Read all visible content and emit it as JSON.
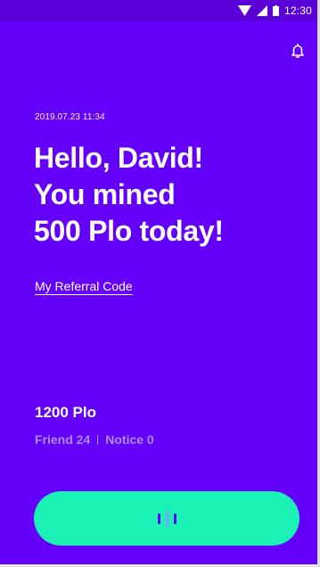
{
  "colors": {
    "background": "#6400fa",
    "status_bar": "#5a00d6",
    "accent_button": "#19f2b4",
    "muted_text": "#a98cf3"
  },
  "status_bar": {
    "icons": [
      "wifi-icon",
      "signal-icon",
      "battery-icon"
    ],
    "time": "12:30"
  },
  "header": {
    "notification_icon": "bell-icon"
  },
  "main": {
    "timestamp": "2019.07.23 11:34",
    "greeting_lines": [
      "Hello, David!",
      "You mined",
      "500 Plo today!"
    ],
    "referral_link": "My Referral Code",
    "balance": "1200 Plo",
    "stats": {
      "friend": "Friend 24",
      "notice": "Notice 0"
    }
  },
  "mine_button": {
    "icon": "mining-bars-icon"
  }
}
